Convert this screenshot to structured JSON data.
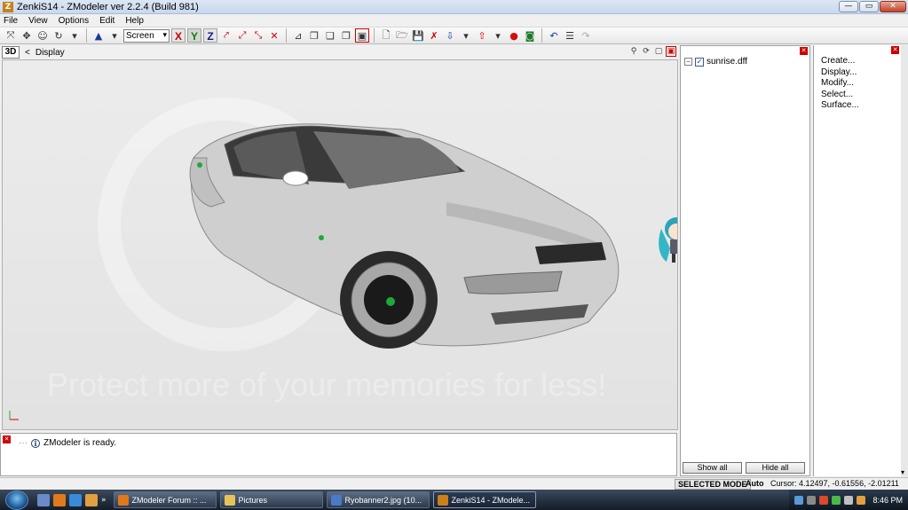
{
  "window": {
    "title": "ZenkiS14 - ZModeler ver 2.2.4 (Build 981)",
    "icon": "zmodeler-app-icon",
    "minimize": "—",
    "maximize": "▭",
    "close": "✕"
  },
  "menu": {
    "items": [
      "File",
      "View",
      "Options",
      "Edit",
      "Help"
    ]
  },
  "toolbar": {
    "view_select": "Screen",
    "axis_x": "X",
    "axis_y": "Y",
    "axis_z": "Z"
  },
  "viewport": {
    "mode": "3D",
    "arrow": "<",
    "label": "Display",
    "ctrl_icons": [
      "magnifier-icon",
      "rotate-view-icon",
      "fit-view-icon",
      "close-icon"
    ],
    "watermark_logo": "photobucket",
    "watermark_text": "Protect more of your memories for less!"
  },
  "tree": {
    "expander": "−",
    "check": "✓",
    "item": "sunrise.dff",
    "show_all": "Show all",
    "hide_all": "Hide all"
  },
  "commands": {
    "items": [
      "Create...",
      "Display...",
      "Modify...",
      "Select...",
      "Surface..."
    ]
  },
  "log": {
    "close": "✕",
    "info": "i",
    "message": "ZModeler is ready."
  },
  "status": {
    "mode": "SELECTED MODE",
    "auto": "Auto",
    "cursor": "Cursor: 4.12497, -0.61556, -2.01211"
  },
  "taskbar": {
    "chevron": "»",
    "tasks": [
      {
        "label": "ZModeler Forum :: ...",
        "icon_color": "#e0781c"
      },
      {
        "label": "Pictures",
        "icon_color": "#e6c35a"
      },
      {
        "label": "Ryobanner2.jpg (10...",
        "icon_color": "#4a7ac8"
      },
      {
        "label": "ZenkiS14 - ZModele...",
        "icon_color": "#c8801c"
      }
    ],
    "clock": "8:46 PM"
  }
}
